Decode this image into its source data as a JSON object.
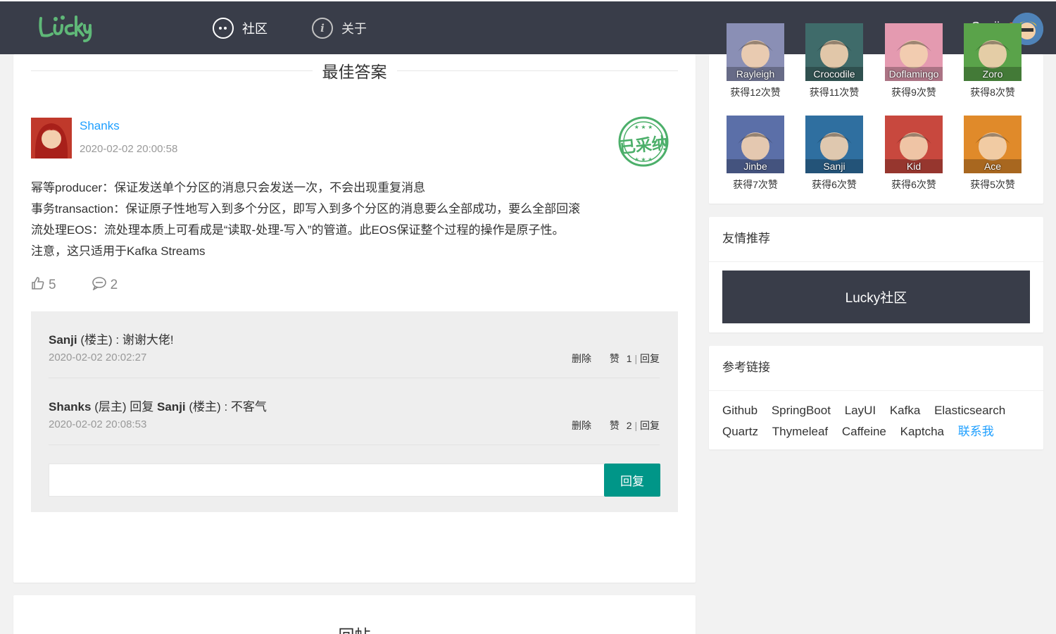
{
  "header": {
    "logo_text": "Lucky",
    "nav": [
      {
        "label": "社区",
        "icon": "chat-icon"
      },
      {
        "label": "关于",
        "icon": "info-icon"
      }
    ],
    "user": "Sanji"
  },
  "best_answer": {
    "section_title": "最佳答案",
    "author": "Shanks",
    "time": "2020-02-02 20:00:58",
    "stamp": "已采纳",
    "lines": [
      "幂等producer：保证发送单个分区的消息只会发送一次，不会出现重复消息",
      "事务transaction：保证原子性地写入到多个分区，即写入到多个分区的消息要么全部成功，要么全部回滚",
      "流处理EOS：流处理本质上可看成是“读取-处理-写入”的管道。此EOS保证整个过程的操作是原子性。",
      "注意，这只适用于Kafka Streams"
    ],
    "likes": "5",
    "comments": "2"
  },
  "replies": [
    {
      "user": "Sanji",
      "role": "(楼主)",
      "target_user": "",
      "target_role": "",
      "reply_word": "",
      "text": ": 谢谢大佬!",
      "time": "2020-02-02 20:02:27",
      "delete": "删除",
      "like": "赞",
      "like_count": "1",
      "reply": "回复"
    },
    {
      "user": "Shanks",
      "role": "(层主)",
      "reply_word": "回复",
      "target_user": "Sanji",
      "target_role": "(楼主)",
      "text": ": 不客气",
      "time": "2020-02-02 20:08:53",
      "delete": "删除",
      "like": "赞",
      "like_count": "2",
      "reply": "回复"
    }
  ],
  "reply_form": {
    "button": "回复",
    "value": ""
  },
  "second_section_title": "回帖",
  "ranking": [
    {
      "name": "Rayleigh",
      "count": "获得12次赞",
      "color": "#8a8fb5"
    },
    {
      "name": "Crocodile",
      "count": "获得11次赞",
      "color": "#3f6b6a"
    },
    {
      "name": "Doflamingo",
      "count": "获得9次赞",
      "color": "#e49ab0"
    },
    {
      "name": "Zoro",
      "count": "获得8次赞",
      "color": "#5aa34a"
    },
    {
      "name": "Jinbe",
      "count": "获得7次赞",
      "color": "#5b6fa8"
    },
    {
      "name": "Sanji",
      "count": "获得6次赞",
      "color": "#2f6fa0"
    },
    {
      "name": "Kid",
      "count": "获得6次赞",
      "color": "#c8483e"
    },
    {
      "name": "Ace",
      "count": "获得5次赞",
      "color": "#e08a2a"
    }
  ],
  "friends": {
    "title": "友情推荐",
    "button": "Lucky社区"
  },
  "references": {
    "title": "参考链接",
    "links": [
      "Github",
      "SpringBoot",
      "LayUI",
      "Kafka",
      "Elasticsearch",
      "Quartz",
      "Thymeleaf",
      "Caffeine",
      "Kaptcha"
    ],
    "contact": "联系我"
  }
}
